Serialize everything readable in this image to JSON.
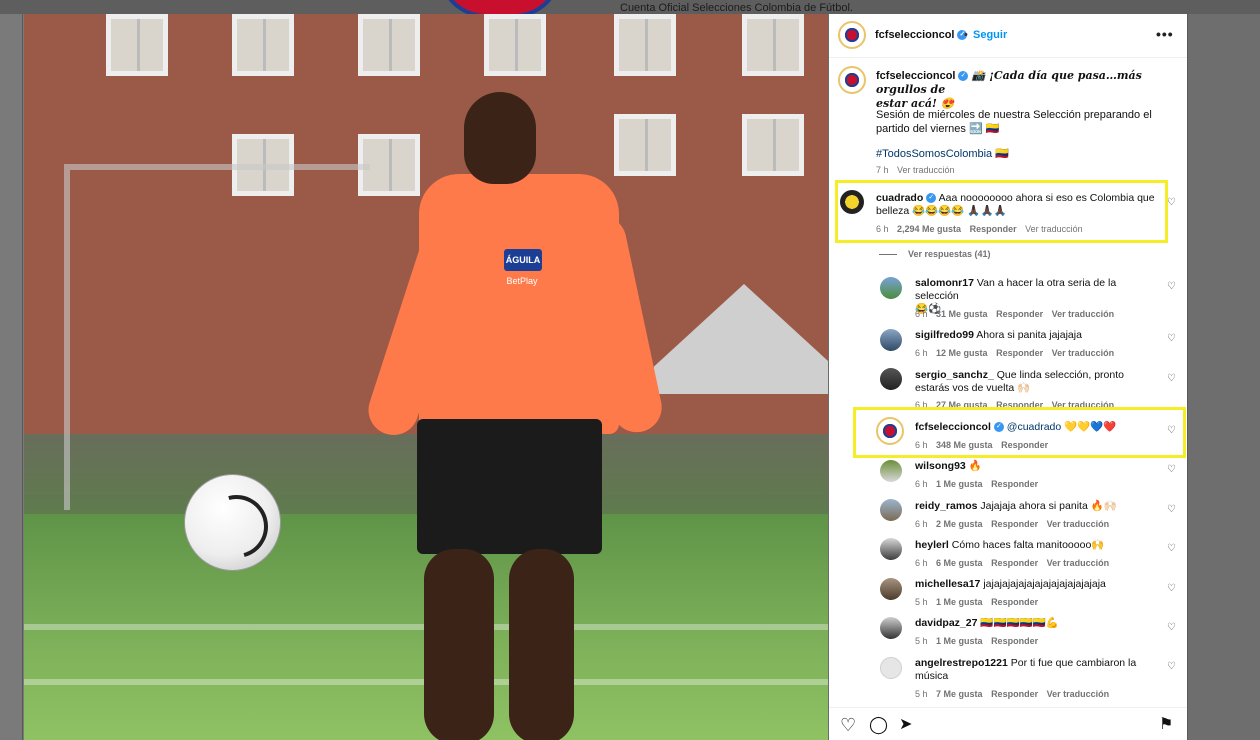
{
  "background": {
    "caption": "Cuenta Oficial Selecciones Colombia de Fútbol."
  },
  "photo": {
    "badge": "ÁGUILA",
    "sponsor": "BetPlay",
    "next_arrow": "›"
  },
  "post": {
    "header_username": "fcfseleccioncol",
    "follow_label": "Seguir",
    "more_label": "•••",
    "caption_username": "fcfseleccioncol",
    "caption_line1": "📸 ¡Cada día que pasa…más orgullos de",
    "caption_line2": "estar acá! 😍",
    "caption_para2_line1": "Sesión de miércoles de nuestra Selección preparando el",
    "caption_para2_line2": "partido del viernes 🔜 🇨🇴",
    "hashtag": "#TodosSomosColombia 🇨🇴",
    "caption_time": "7 h",
    "caption_translate": "Ver traducción"
  },
  "comments": [
    {
      "user": "cuadrado",
      "verified": true,
      "text_line1": "Aaa noooooooo ahora si eso es Colombia que",
      "text_line2": "belleza 😂😂😂😂 🙏🏿🙏🏿🙏🏿",
      "time": "6 h",
      "likes": "2,294 Me gusta",
      "reply": "Responder",
      "translate": "Ver traducción"
    }
  ],
  "view_replies": "Ver respuestas (41)",
  "replies": [
    {
      "user": "salomonr17",
      "text_line1": "Van a hacer la otra seria de la selección",
      "text_line2": "😂⚽",
      "time": "6 h",
      "likes": "31 Me gusta",
      "reply": "Responder",
      "translate": "Ver traducción"
    },
    {
      "user": "sigilfredo99",
      "text_line1": "Ahora si panita jajajaja",
      "text_line2": "",
      "time": "6 h",
      "likes": "12 Me gusta",
      "reply": "Responder",
      "translate": "Ver traducción"
    },
    {
      "user": "sergio_sanchz_",
      "text_line1": "Que linda selección, pronto",
      "text_line2": "estarás vos de vuelta 🙌🏻",
      "time": "6 h",
      "likes": "27 Me gusta",
      "reply": "Responder",
      "translate": "Ver traducción"
    },
    {
      "user": "fcfseleccioncol",
      "verified": true,
      "text_line1": "@cuadrado 💛💛💙❤️",
      "text_line2": "",
      "time": "6 h",
      "likes": "348 Me gusta",
      "reply": "Responder",
      "translate": ""
    },
    {
      "user": "wilsong93",
      "text_line1": "🔥",
      "text_line2": "",
      "time": "6 h",
      "likes": "1 Me gusta",
      "reply": "Responder",
      "translate": ""
    },
    {
      "user": "reidy_ramos",
      "text_line1": "Jajajaja ahora si panita 🔥🙌🏻",
      "text_line2": "",
      "time": "6 h",
      "likes": "2 Me gusta",
      "reply": "Responder",
      "translate": "Ver traducción"
    },
    {
      "user": "heylerl",
      "text_line1": "Cómo haces falta manitooooo🙌",
      "text_line2": "",
      "time": "6 h",
      "likes": "6 Me gusta",
      "reply": "Responder",
      "translate": "Ver traducción"
    },
    {
      "user": "michellesa17",
      "text_line1": "jajajajajajajajajajajajajajaja",
      "text_line2": "",
      "time": "5 h",
      "likes": "1 Me gusta",
      "reply": "Responder",
      "translate": ""
    },
    {
      "user": "davidpaz_27",
      "text_line1": "🇨🇴🇨🇴🇨🇴🇨🇴🇨🇴💪",
      "text_line2": "",
      "time": "5 h",
      "likes": "1 Me gusta",
      "reply": "Responder",
      "translate": ""
    },
    {
      "user": "angelrestrepo1221",
      "text_line1": "Por ti fue que cambiaron la",
      "text_line2": "música",
      "time": "5 h",
      "likes": "7 Me gusta",
      "reply": "Responder",
      "translate": "Ver traducción"
    }
  ],
  "icons": {
    "heart": "♡",
    "comment": "◯",
    "share": "➤",
    "bookmark": "⚑",
    "verified": "✓"
  },
  "colors": {
    "highlight": "#f5ee26",
    "link": "#00376b",
    "follow": "#0095f6",
    "verified": "#3897f0"
  }
}
